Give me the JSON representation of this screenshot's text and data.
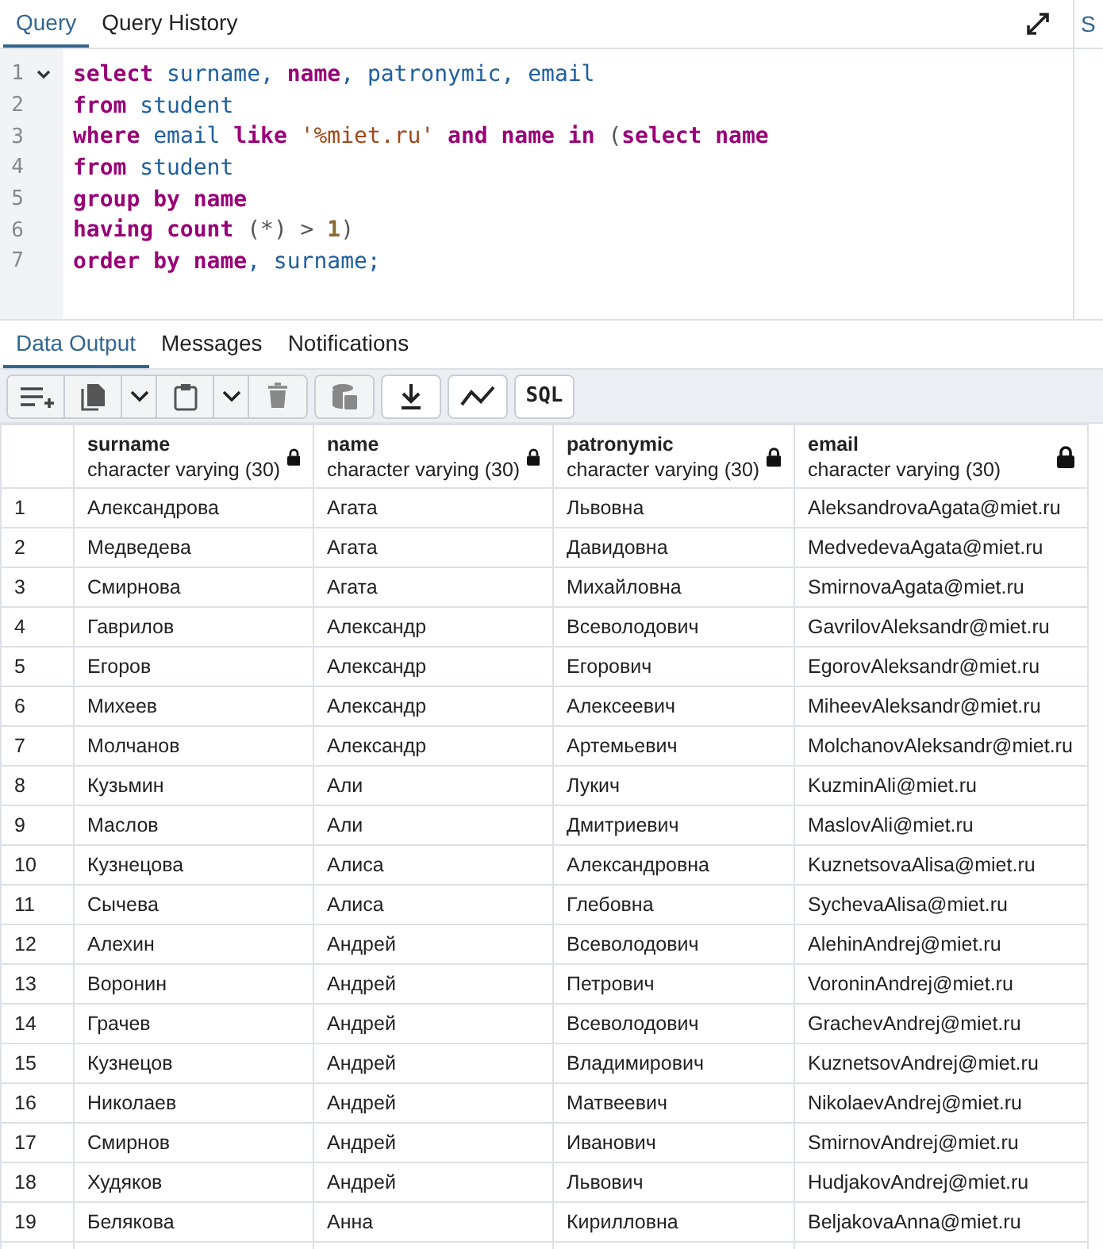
{
  "query_tabs": [
    {
      "label": "Query",
      "selected": true
    },
    {
      "label": "Query History",
      "selected": false
    }
  ],
  "side_tab": {
    "label": "S"
  },
  "editor": {
    "lines": [
      {
        "number": "1",
        "foldable": true,
        "tokens": [
          {
            "text": "select",
            "kind": "kw"
          },
          {
            "text": " surname, ",
            "kind": "id"
          },
          {
            "text": "name",
            "kind": "kw"
          },
          {
            "text": ", patronymic, email",
            "kind": "id"
          }
        ]
      },
      {
        "number": "2",
        "foldable": false,
        "tokens": [
          {
            "text": "from",
            "kind": "kw"
          },
          {
            "text": " student",
            "kind": "id"
          }
        ]
      },
      {
        "number": "3",
        "foldable": false,
        "tokens": [
          {
            "text": "where",
            "kind": "kw"
          },
          {
            "text": " email ",
            "kind": "id"
          },
          {
            "text": "like",
            "kind": "kw"
          },
          {
            "text": " '%miet.ru'",
            "kind": "str"
          },
          {
            "text": " and name in",
            "kind": "kw"
          },
          {
            "text": " (",
            "kind": "punct"
          },
          {
            "text": "select name",
            "kind": "kw"
          }
        ]
      },
      {
        "number": "4",
        "foldable": false,
        "tokens": [
          {
            "text": "from",
            "kind": "kw"
          },
          {
            "text": " student",
            "kind": "id"
          }
        ]
      },
      {
        "number": "5",
        "foldable": false,
        "tokens": [
          {
            "text": "group by name",
            "kind": "kw"
          }
        ]
      },
      {
        "number": "6",
        "foldable": false,
        "tokens": [
          {
            "text": "having count",
            "kind": "kw"
          },
          {
            "text": " (*) > ",
            "kind": "punct"
          },
          {
            "text": "1",
            "kind": "num"
          },
          {
            "text": ")",
            "kind": "punct"
          }
        ]
      },
      {
        "number": "7",
        "foldable": false,
        "tokens": [
          {
            "text": "order by name",
            "kind": "kw"
          },
          {
            "text": ", surname;",
            "kind": "id"
          }
        ]
      }
    ]
  },
  "output_tabs": [
    {
      "label": "Data Output",
      "selected": true
    },
    {
      "label": "Messages",
      "selected": false
    },
    {
      "label": "Notifications",
      "selected": false
    }
  ],
  "toolbar": [
    {
      "kind": "add-row"
    },
    {
      "kind": "copy"
    },
    {
      "kind": "dropdown"
    },
    {
      "kind": "paste"
    },
    {
      "kind": "dropdown"
    },
    {
      "kind": "delete"
    },
    {
      "kind": "save-data"
    },
    {
      "kind": "download"
    },
    {
      "kind": "graph"
    },
    {
      "kind": "sql",
      "label": "SQL"
    }
  ],
  "table": {
    "columns": [
      {
        "name": "surname",
        "type": "character varying (30)"
      },
      {
        "name": "name",
        "type": "character varying (30)"
      },
      {
        "name": "patronymic",
        "type": "character varying (30)"
      },
      {
        "name": "email",
        "type": "character varying (30)"
      }
    ],
    "rows": [
      {
        "number": "1",
        "cells": [
          "Александрова",
          "Агата",
          "Львовна",
          "AleksandrovaAgata@miet.ru"
        ]
      },
      {
        "number": "2",
        "cells": [
          "Медведева",
          "Агата",
          "Давидовна",
          "MedvedevaAgata@miet.ru"
        ]
      },
      {
        "number": "3",
        "cells": [
          "Смирнова",
          "Агата",
          "Михайловна",
          "SmirnovaAgata@miet.ru"
        ]
      },
      {
        "number": "4",
        "cells": [
          "Гаврилов",
          "Александр",
          "Всеволодович",
          "GavrilovAleksandr@miet.ru"
        ]
      },
      {
        "number": "5",
        "cells": [
          "Егоров",
          "Александр",
          "Егорович",
          "EgorovAleksandr@miet.ru"
        ]
      },
      {
        "number": "6",
        "cells": [
          "Михеев",
          "Александр",
          "Алексеевич",
          "MiheevAleksandr@miet.ru"
        ]
      },
      {
        "number": "7",
        "cells": [
          "Молчанов",
          "Александр",
          "Артемьевич",
          "MolchanovAleksandr@miet.ru"
        ]
      },
      {
        "number": "8",
        "cells": [
          "Кузьмин",
          "Али",
          "Лукич",
          "KuzminAli@miet.ru"
        ]
      },
      {
        "number": "9",
        "cells": [
          "Маслов",
          "Али",
          "Дмитриевич",
          "MaslovAli@miet.ru"
        ]
      },
      {
        "number": "10",
        "cells": [
          "Кузнецова",
          "Алиса",
          "Александровна",
          "KuznetsovaAlisa@miet.ru"
        ]
      },
      {
        "number": "11",
        "cells": [
          "Сычева",
          "Алиса",
          "Глебовна",
          "SychevaAlisa@miet.ru"
        ]
      },
      {
        "number": "12",
        "cells": [
          "Алехин",
          "Андрей",
          "Всеволодович",
          "AlehinAndrej@miet.ru"
        ]
      },
      {
        "number": "13",
        "cells": [
          "Воронин",
          "Андрей",
          "Петрович",
          "VoroninAndrej@miet.ru"
        ]
      },
      {
        "number": "14",
        "cells": [
          "Грачев",
          "Андрей",
          "Всеволодович",
          "GrachevAndrej@miet.ru"
        ]
      },
      {
        "number": "15",
        "cells": [
          "Кузнецов",
          "Андрей",
          "Владимирович",
          "KuznetsovAndrej@miet.ru"
        ]
      },
      {
        "number": "16",
        "cells": [
          "Николаев",
          "Андрей",
          "Матвеевич",
          "NikolaevAndrej@miet.ru"
        ]
      },
      {
        "number": "17",
        "cells": [
          "Смирнов",
          "Андрей",
          "Иванович",
          "SmirnovAndrej@miet.ru"
        ]
      },
      {
        "number": "18",
        "cells": [
          "Худяков",
          "Андрей",
          "Львович",
          "HudjakovAndrej@miet.ru"
        ]
      },
      {
        "number": "19",
        "cells": [
          "Белякова",
          "Анна",
          "Кирилловна",
          "BeljakovaAnna@miet.ru"
        ]
      }
    ]
  }
}
